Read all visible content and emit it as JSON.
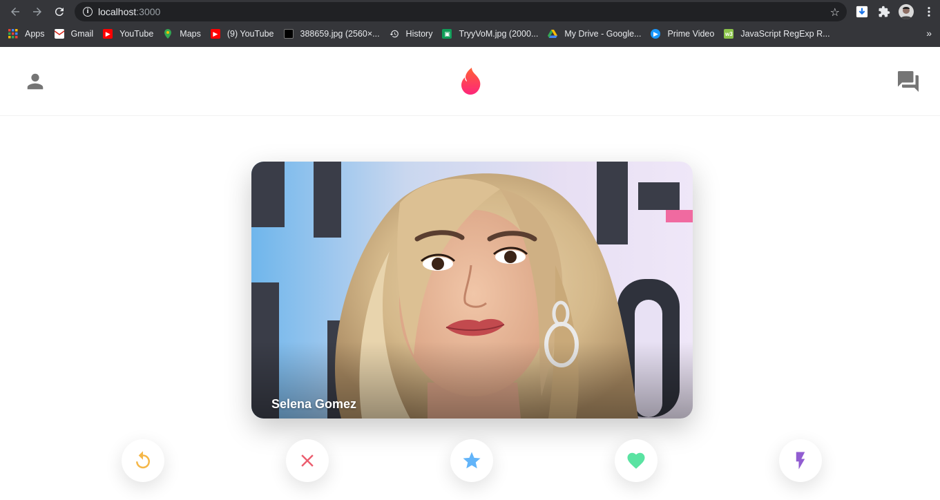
{
  "browser": {
    "url_host": "localhost",
    "url_port": ":3000",
    "bookmarks": [
      {
        "label": "Apps",
        "icon": "apps-grid-icon",
        "color": "#ea4335"
      },
      {
        "label": "Gmail",
        "icon": "gmail-icon",
        "color": "#d93025"
      },
      {
        "label": "YouTube",
        "icon": "youtube-icon",
        "color": "#ff0000"
      },
      {
        "label": "Maps",
        "icon": "maps-icon",
        "color": "#34a853"
      },
      {
        "label": "(9) YouTube",
        "icon": "youtube-icon",
        "color": "#ff0000"
      },
      {
        "label": "388659.jpg (2560×...",
        "icon": "image-icon",
        "color": "#202124"
      },
      {
        "label": "History",
        "icon": "history-icon",
        "color": "#e8eaed"
      },
      {
        "label": "TryyVoM.jpg (2000...",
        "icon": "image-icon",
        "color": "#0f9d58"
      },
      {
        "label": "My Drive - Google...",
        "icon": "drive-icon",
        "color": "#fbbc04"
      },
      {
        "label": "Prime Video",
        "icon": "prime-video-icon",
        "color": "#1a98ff"
      },
      {
        "label": "JavaScript RegExp R...",
        "icon": "w3-icon",
        "color": "#8bc34a"
      }
    ],
    "more_label": "»"
  },
  "header": {
    "profile_icon": "person-icon",
    "logo_icon": "flame-logo-icon",
    "chat_icon": "forum-icon"
  },
  "card": {
    "name": "Selena Gomez"
  },
  "actions": [
    {
      "name": "rewind-button",
      "icon": "replay-icon",
      "color": "#f5b748"
    },
    {
      "name": "nope-button",
      "icon": "close-icon",
      "color": "#ec5e6f"
    },
    {
      "name": "super-like-button",
      "icon": "star-icon",
      "color": "#62b4f9"
    },
    {
      "name": "like-button",
      "icon": "heart-icon",
      "color": "#5ae3a2"
    },
    {
      "name": "boost-button",
      "icon": "flash-icon",
      "color": "#915dd1"
    }
  ],
  "colors": {
    "brand_gradient_start": "#fd267a",
    "brand_gradient_end": "#ff6036",
    "header_icon": "#757575"
  }
}
